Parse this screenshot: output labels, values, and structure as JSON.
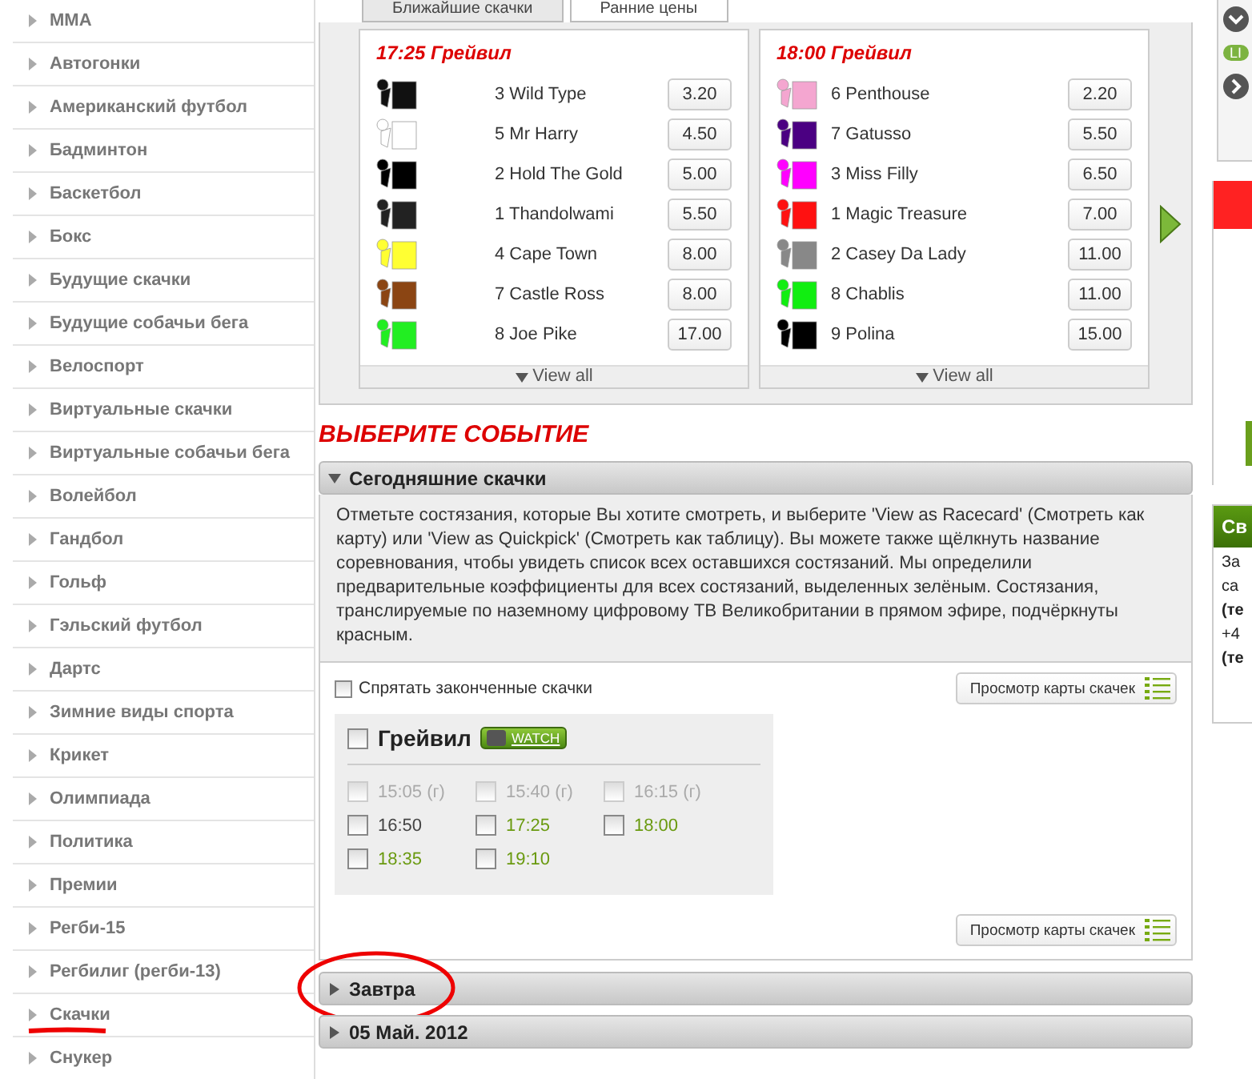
{
  "sidebar": {
    "items": [
      {
        "label": "MMA",
        "selected": false
      },
      {
        "label": "Автогонки",
        "selected": false
      },
      {
        "label": "Американский футбол",
        "selected": false
      },
      {
        "label": "Бадминтон",
        "selected": false
      },
      {
        "label": "Баскетбол",
        "selected": false
      },
      {
        "label": "Бокс",
        "selected": false
      },
      {
        "label": "Будущие скачки",
        "selected": false
      },
      {
        "label": "Будущие собачьи бега",
        "selected": false
      },
      {
        "label": "Велоспорт",
        "selected": false
      },
      {
        "label": "Виртуальные скачки",
        "selected": false
      },
      {
        "label": "Виртуальные собачьи бега",
        "selected": false
      },
      {
        "label": "Волейбол",
        "selected": false
      },
      {
        "label": "Гандбол",
        "selected": false
      },
      {
        "label": "Гольф",
        "selected": false
      },
      {
        "label": "Гэльский футбол",
        "selected": false
      },
      {
        "label": "Дартс",
        "selected": false
      },
      {
        "label": "Зимние виды спорта",
        "selected": false
      },
      {
        "label": "Крикет",
        "selected": false
      },
      {
        "label": "Олимпиада",
        "selected": false
      },
      {
        "label": "Политика",
        "selected": false
      },
      {
        "label": "Премии",
        "selected": false
      },
      {
        "label": "Регби-15",
        "selected": false
      },
      {
        "label": "Регбилиг (регби-13)",
        "selected": false
      },
      {
        "label": "Скачки",
        "selected": false
      },
      {
        "label": "Снукер",
        "selected": false
      }
    ]
  },
  "tabs": [
    {
      "label": "Ближайшие скачки",
      "selected": false
    },
    {
      "label": "Ранние цены",
      "selected": true
    }
  ],
  "races": [
    {
      "title": "17:25 Грейвил",
      "view_all": "View all",
      "runners": [
        {
          "name": "3 Wild Type",
          "odds": "3.20",
          "color": "#111111"
        },
        {
          "name": "5 Mr Harry",
          "odds": "4.50",
          "color": "#ffffff"
        },
        {
          "name": "2 Hold The Gold",
          "odds": "5.00",
          "color": "#000000"
        },
        {
          "name": "1 Thandolwami",
          "odds": "5.50",
          "color": "#222222"
        },
        {
          "name": "4 Cape Town",
          "odds": "8.00",
          "color": "#ffff33"
        },
        {
          "name": "7 Castle Ross",
          "odds": "8.00",
          "color": "#8b4513"
        },
        {
          "name": "8 Joe Pike",
          "odds": "17.00",
          "color": "#22ee22"
        }
      ]
    },
    {
      "title": "18:00 Грейвил",
      "view_all": "View all",
      "runners": [
        {
          "name": "6 Penthouse",
          "odds": "2.20",
          "color": "#f4a6d0"
        },
        {
          "name": "7 Gatusso",
          "odds": "5.50",
          "color": "#4b0082"
        },
        {
          "name": "3 Miss Filly",
          "odds": "6.50",
          "color": "#ff00ff"
        },
        {
          "name": "1 Magic Treasure",
          "odds": "7.00",
          "color": "#ff1111"
        },
        {
          "name": "2 Casey Da Lady",
          "odds": "11.00",
          "color": "#888888"
        },
        {
          "name": "8 Chablis",
          "odds": "11.00",
          "color": "#11ee11"
        },
        {
          "name": "9 Polina",
          "odds": "15.00",
          "color": "#000000"
        }
      ]
    }
  ],
  "heading": "ВЫБЕРИТЕ СОБЫТИЕ",
  "today": {
    "title": "Сегодняшние скачки",
    "expanded": true,
    "description": "Отметьте состязания, которые Вы хотите смотреть, и выберите 'View as Racecard' (Смотреть как карту) или 'View as Quickpick' (Смотреть как таблицу). Вы можете также щёлкнуть название соревнования, чтобы увидеть список всех оставшихся состязаний. Мы определили предварительные коэффициенты для всех состязаний, выделенных зелёным. Состязания, транслируемые по наземному цифровому ТВ Великобритании в прямом эфире, подчёркнуты красным.",
    "hide_finished": {
      "label": "Спрятать законченные скачки",
      "checked": false
    },
    "view_button": "Просмотр карты скачек",
    "meeting": {
      "name": "Грейвил",
      "checked": false,
      "watch": "WATCH",
      "times": [
        {
          "time": "15:05 (г)",
          "checked": false,
          "kind": "finished"
        },
        {
          "time": "15:40 (г)",
          "checked": false,
          "kind": "finished"
        },
        {
          "time": "16:15 (г)",
          "checked": false,
          "kind": "finished"
        },
        {
          "time": "16:50",
          "checked": false,
          "kind": "plain"
        },
        {
          "time": "17:25",
          "checked": false,
          "kind": "priced"
        },
        {
          "time": "18:00",
          "checked": false,
          "kind": "priced"
        },
        {
          "time": "18:35",
          "checked": false,
          "kind": "priced"
        },
        {
          "time": "19:10",
          "checked": false,
          "kind": "priced"
        }
      ]
    },
    "view_button_bottom": "Просмотр карты скачек"
  },
  "collapsed_sections": [
    {
      "title": "Завтра",
      "expanded": false
    },
    {
      "title": "05 Май. 2012",
      "expanded": false
    }
  ],
  "right_panel": {
    "badge": "LI",
    "header": "Св",
    "lines": [
      "За",
      "са",
      "(те",
      "+4",
      "(те"
    ]
  }
}
